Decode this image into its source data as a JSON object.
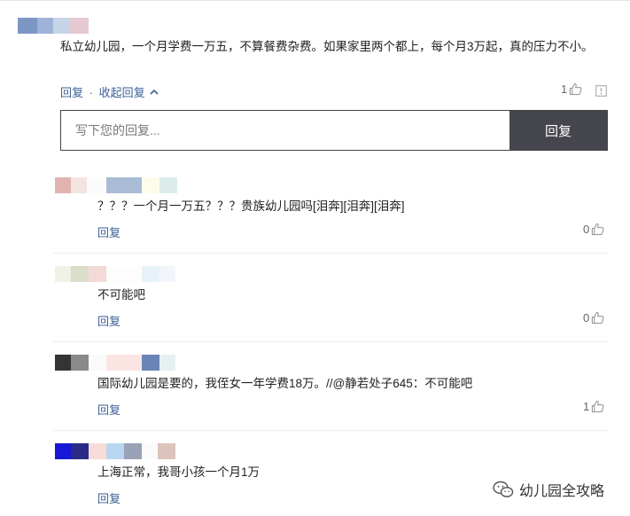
{
  "main_comment": {
    "text": "私立幼儿园，一个月学费一万五，不算餐费杂费。如果家里两个都上，每个月3万起，真的压力不小。",
    "reply_label": "回复",
    "separator": "·",
    "collapse_label": "收起回复",
    "likes": "1"
  },
  "reply_box": {
    "placeholder": "写下您的回复...",
    "submit_label": "回复"
  },
  "replies": [
    {
      "text": "？？？一个月一万五？？？贵族幼儿园吗[泪奔][泪奔][泪奔]",
      "reply_label": "回复",
      "likes": "0"
    },
    {
      "text": "不可能吧",
      "reply_label": "回复",
      "likes": "0"
    },
    {
      "text": "国际幼儿园是要的，我侄女一年学费18万。//@静若处子645：不可能吧",
      "reply_label": "回复",
      "likes": "1"
    },
    {
      "text": "上海正常，我哥小孩一个月1万",
      "reply_label": "回复",
      "likes": ""
    }
  ],
  "watermark": {
    "text": "幼儿园全攻略",
    "icon": "wechat-icon"
  },
  "colors": {
    "link": "#3b5f96",
    "submit_bg": "#45454d"
  }
}
